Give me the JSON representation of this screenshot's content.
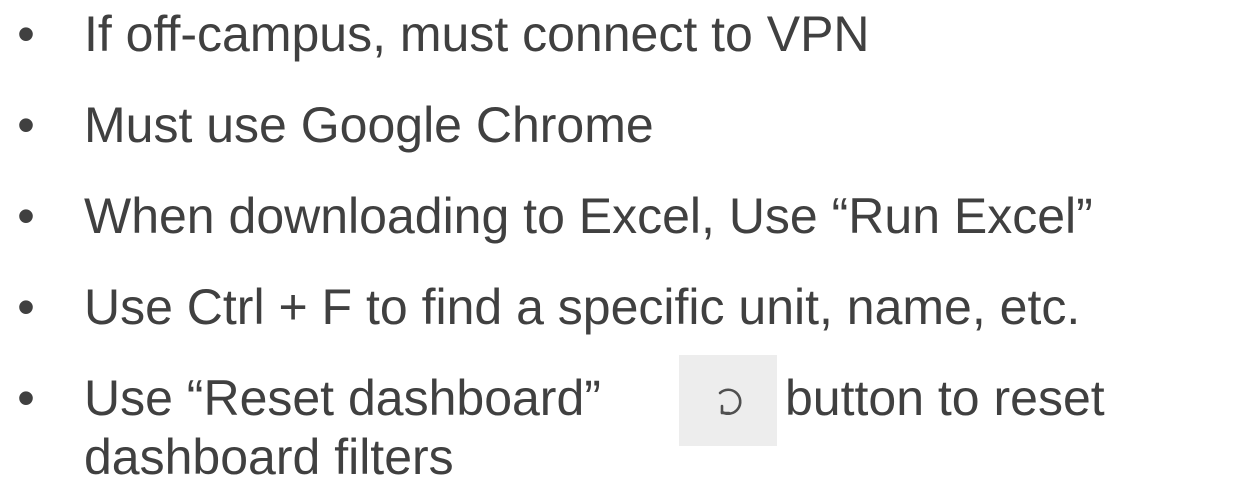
{
  "bullet_char": "•",
  "bullets": [
    {
      "text": "If off-campus, must connect to VPN"
    },
    {
      "text": "Must use Google Chrome"
    },
    {
      "text": "When downloading to Excel, Use “Run Excel”"
    },
    {
      "text": "Use Ctrl + F to find a specific unit, name, etc."
    },
    {
      "text_before": "Use “Reset dashboard”",
      "button_icon": "reset-icon",
      "text_after": "button to reset",
      "text_wrap": "dashboard filters"
    }
  ],
  "colors": {
    "text": "#404040",
    "button_background": "#ededed",
    "icon": "#505050"
  }
}
